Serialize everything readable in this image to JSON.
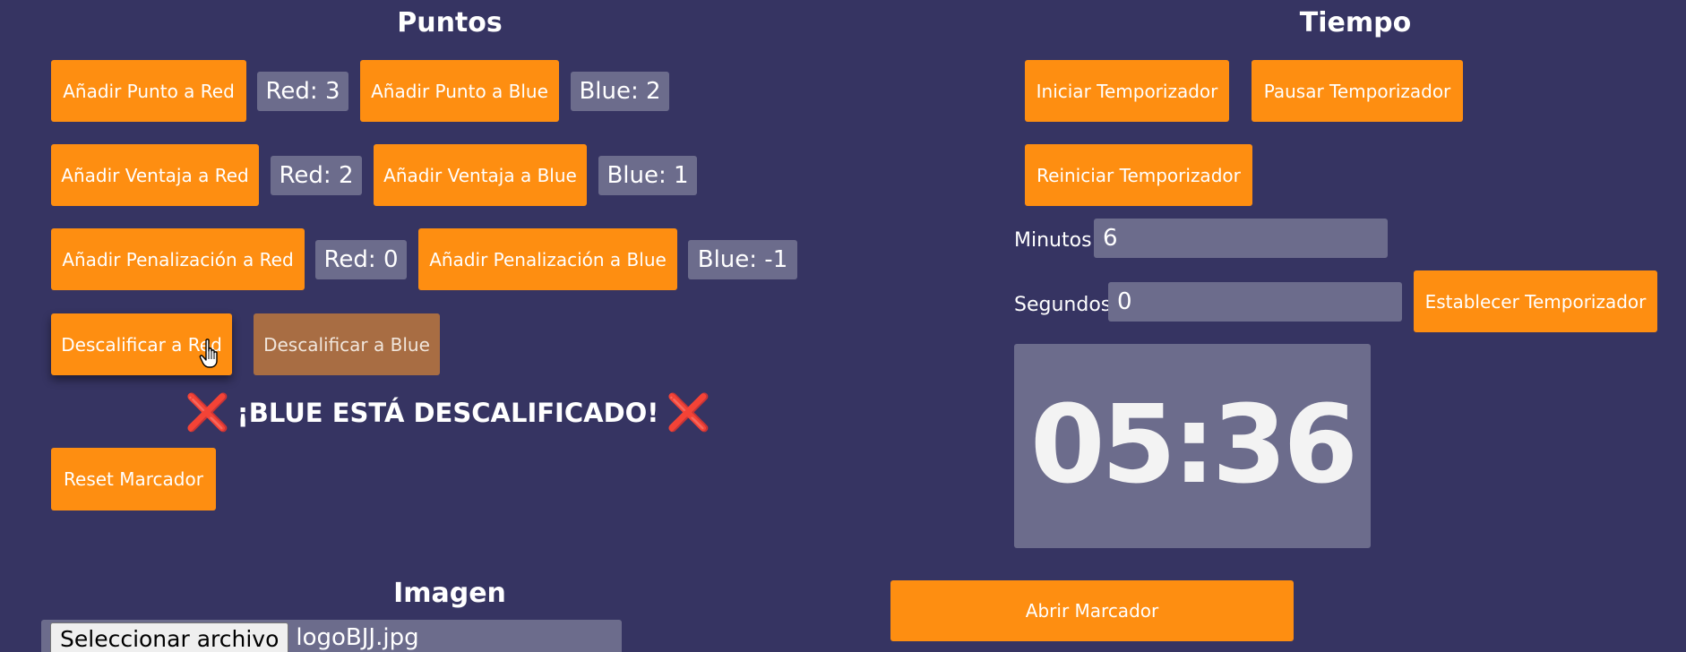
{
  "puntos": {
    "title": "Puntos",
    "add_point_red": "Añadir Punto a Red",
    "red_points": "Red: 3",
    "add_point_blue": "Añadir Punto a Blue",
    "blue_points": "Blue: 2",
    "add_advantage_red": "Añadir Ventaja a Red",
    "red_advantages": "Red: 2",
    "add_advantage_blue": "Añadir Ventaja a Blue",
    "blue_advantages": "Blue: 1",
    "add_penalty_red": "Añadir Penalización a Red",
    "red_penalties": "Red: 0",
    "add_penalty_blue": "Añadir Penalización a Blue",
    "blue_penalties": "Blue: -1",
    "disqualify_red": "Descalificar a Red",
    "disqualify_blue": "Descalificar a Blue",
    "dq_message": "¡BLUE ESTÁ DESCALIFICADO!",
    "x_icon": "❌",
    "reset": "Reset Marcador"
  },
  "tiempo": {
    "title": "Tiempo",
    "start": "Iniciar Temporizador",
    "pause": "Pausar Temporizador",
    "restart": "Reiniciar Temporizador",
    "minutes_label": "Minutos:",
    "minutes_value": "6",
    "seconds_label": "Segundos:",
    "seconds_value": "0",
    "set_timer": "Establecer Temporizador",
    "display": "05:36"
  },
  "imagen": {
    "title": "Imagen",
    "choose_file": "Seleccionar archivo",
    "file_name": "logoBJJ.jpg"
  },
  "open_scoreboard": "Abrir Marcador",
  "colors": {
    "background": "#363462",
    "button": "#fe8e11",
    "button_disabled": "#a86d43",
    "score_box": "#6c6c8c",
    "x_icon": "#ee3f58"
  }
}
